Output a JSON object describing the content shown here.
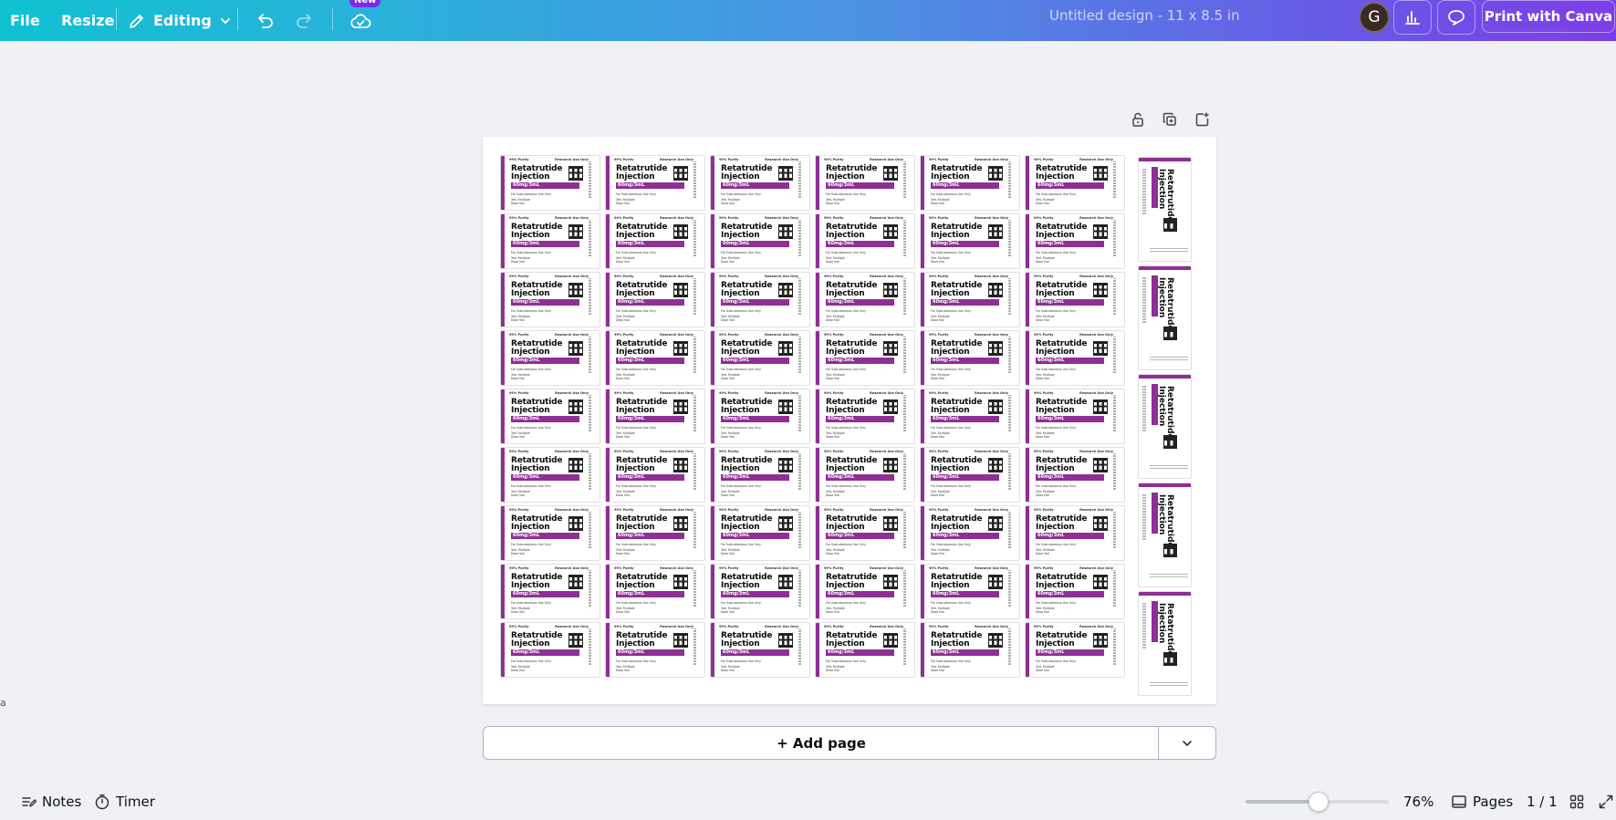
{
  "topbar": {
    "file": "File",
    "resize": "Resize",
    "editing": "Editing",
    "new_badge": "New",
    "doc_title": "Untitled design - 11 x 8.5 in",
    "avatar_initial": "G",
    "print": "Print with Canva"
  },
  "label": {
    "purity": "99% Purity",
    "research": "Research Use Only",
    "name": "Retatrutide\nInjection",
    "dose": "60mg/3mL",
    "use": "For Subcutaneous Use Only",
    "vial": "3mL Multiple\nDose Vial"
  },
  "add_page": "+ Add page",
  "bottom": {
    "notes": "Notes",
    "timer": "Timer",
    "zoom": "76%",
    "zoom_level": 0.5,
    "pages": "Pages",
    "page_count": "1 / 1"
  },
  "left_edge": "a",
  "colors": {
    "accent": "#8e2f94",
    "topbar_start": "#10c1d2",
    "topbar_end": "#7d3ee6"
  }
}
